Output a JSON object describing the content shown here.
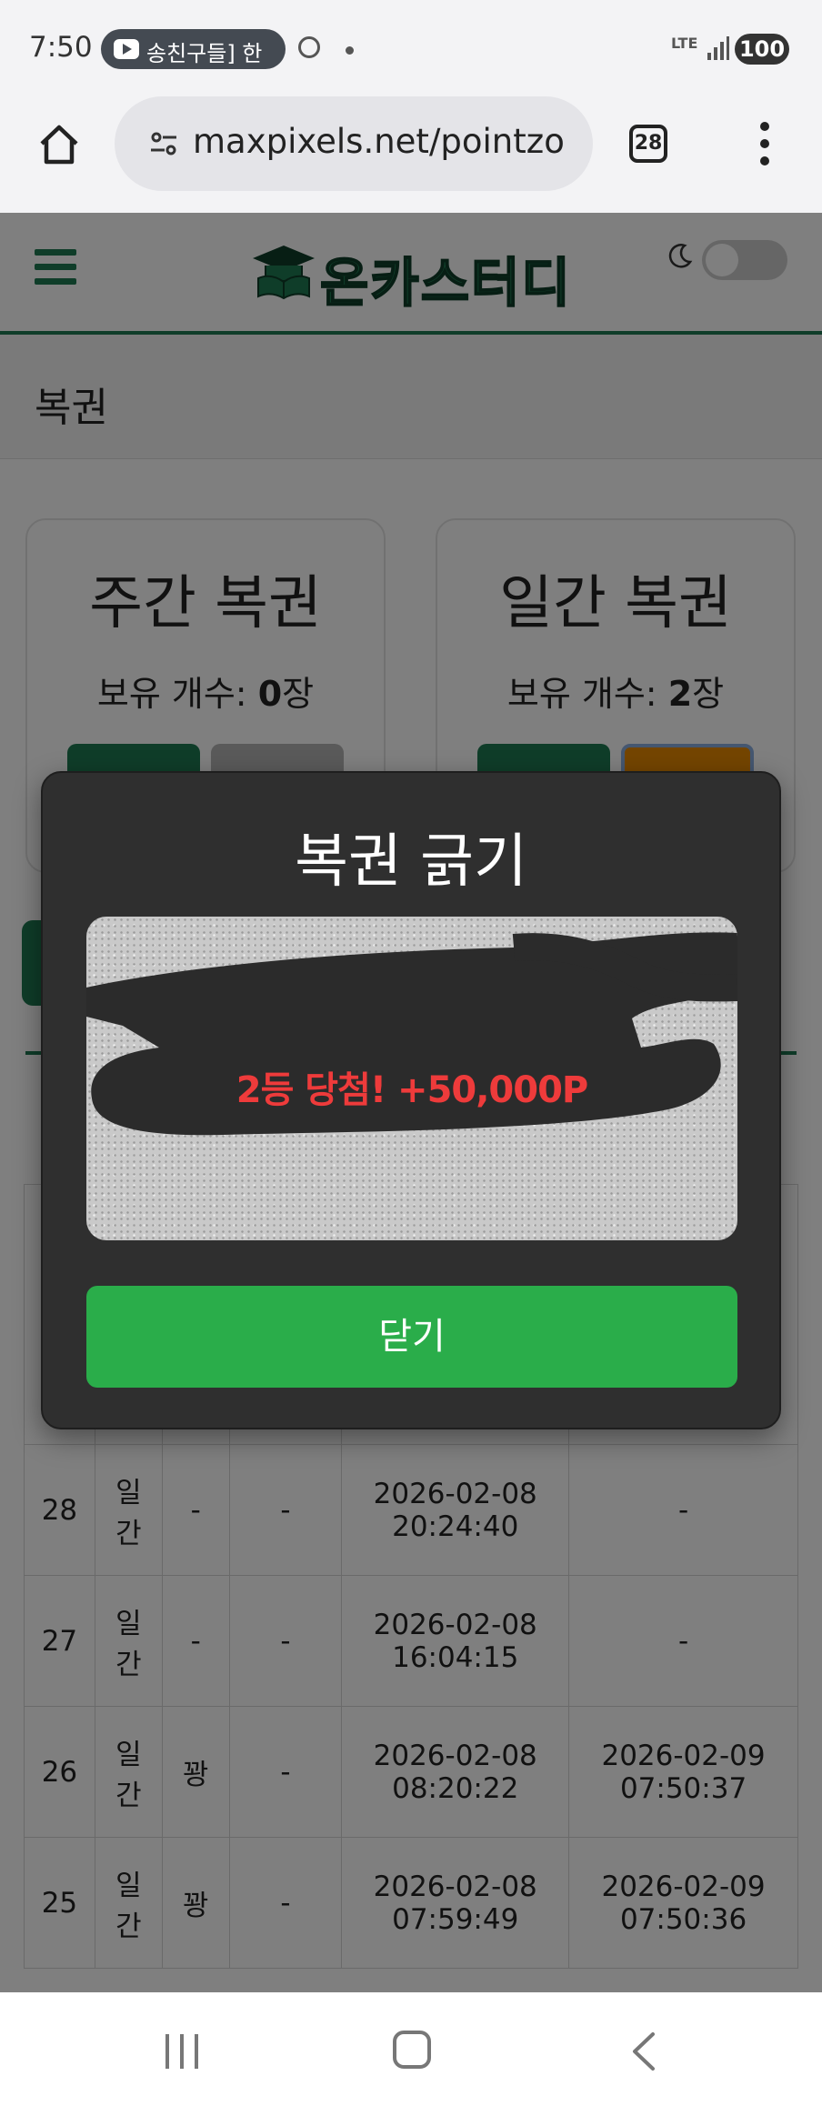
{
  "status_bar": {
    "time": "7:50",
    "notification_text": "송친구들] 한",
    "network": "LTE",
    "battery": "100"
  },
  "browser": {
    "url": "maxpixels.net/pointzo",
    "tab_count": "28"
  },
  "site": {
    "logo_text": "온카스터디",
    "page_title": "복권",
    "colors": {
      "brand_green": "#1f7a52",
      "close_button": "#2aad4a",
      "prize_red": "#ee3b3b",
      "daily_button_orange": "#e98a00"
    }
  },
  "cards": [
    {
      "title": "주간 복권",
      "count_label": "보유 개수: ",
      "count_value": "0",
      "count_unit": "장"
    },
    {
      "title": "일간 복권",
      "count_label": "보유 개수: ",
      "count_value": "2",
      "count_unit": "장"
    }
  ],
  "table": {
    "rows": [
      {
        "no": "28",
        "type": "일간",
        "result": "-",
        "points": "-",
        "issued": "2026-02-08 20:24:40",
        "used": "-"
      },
      {
        "no": "27",
        "type": "일간",
        "result": "-",
        "points": "-",
        "issued": "2026-02-08 16:04:15",
        "used": "-"
      },
      {
        "no": "26",
        "type": "일간",
        "result": "꽝",
        "points": "-",
        "issued": "2026-02-08 08:20:22",
        "used": "2026-02-09 07:50:37"
      },
      {
        "no": "25",
        "type": "일간",
        "result": "꽝",
        "points": "-",
        "issued": "2026-02-08 07:59:49",
        "used": "2026-02-09 07:50:36"
      }
    ]
  },
  "modal": {
    "title": "복권 긁기",
    "prize_text": "2등 당첨! +50,000P",
    "close_label": "닫기"
  }
}
